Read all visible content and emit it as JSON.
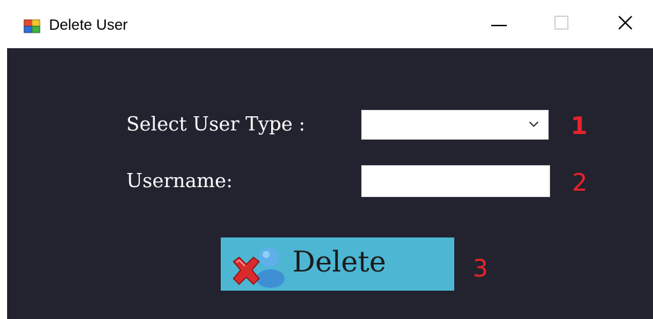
{
  "window": {
    "title": "Delete User",
    "icon": "app-form-icon",
    "controls": [
      "minimize-icon",
      "maximize-icon",
      "close-icon"
    ]
  },
  "form": {
    "user_type": {
      "label": "Select User Type :",
      "selected_value": "",
      "annotation": "1"
    },
    "username": {
      "label": "Username:",
      "value": "",
      "annotation": "2"
    },
    "delete_button": {
      "label": "Delete",
      "icon": "delete-user-icon",
      "annotation": "3"
    }
  },
  "colors": {
    "background": "#22232f",
    "button": "#4db6d3",
    "annotation": "#e8232a"
  }
}
